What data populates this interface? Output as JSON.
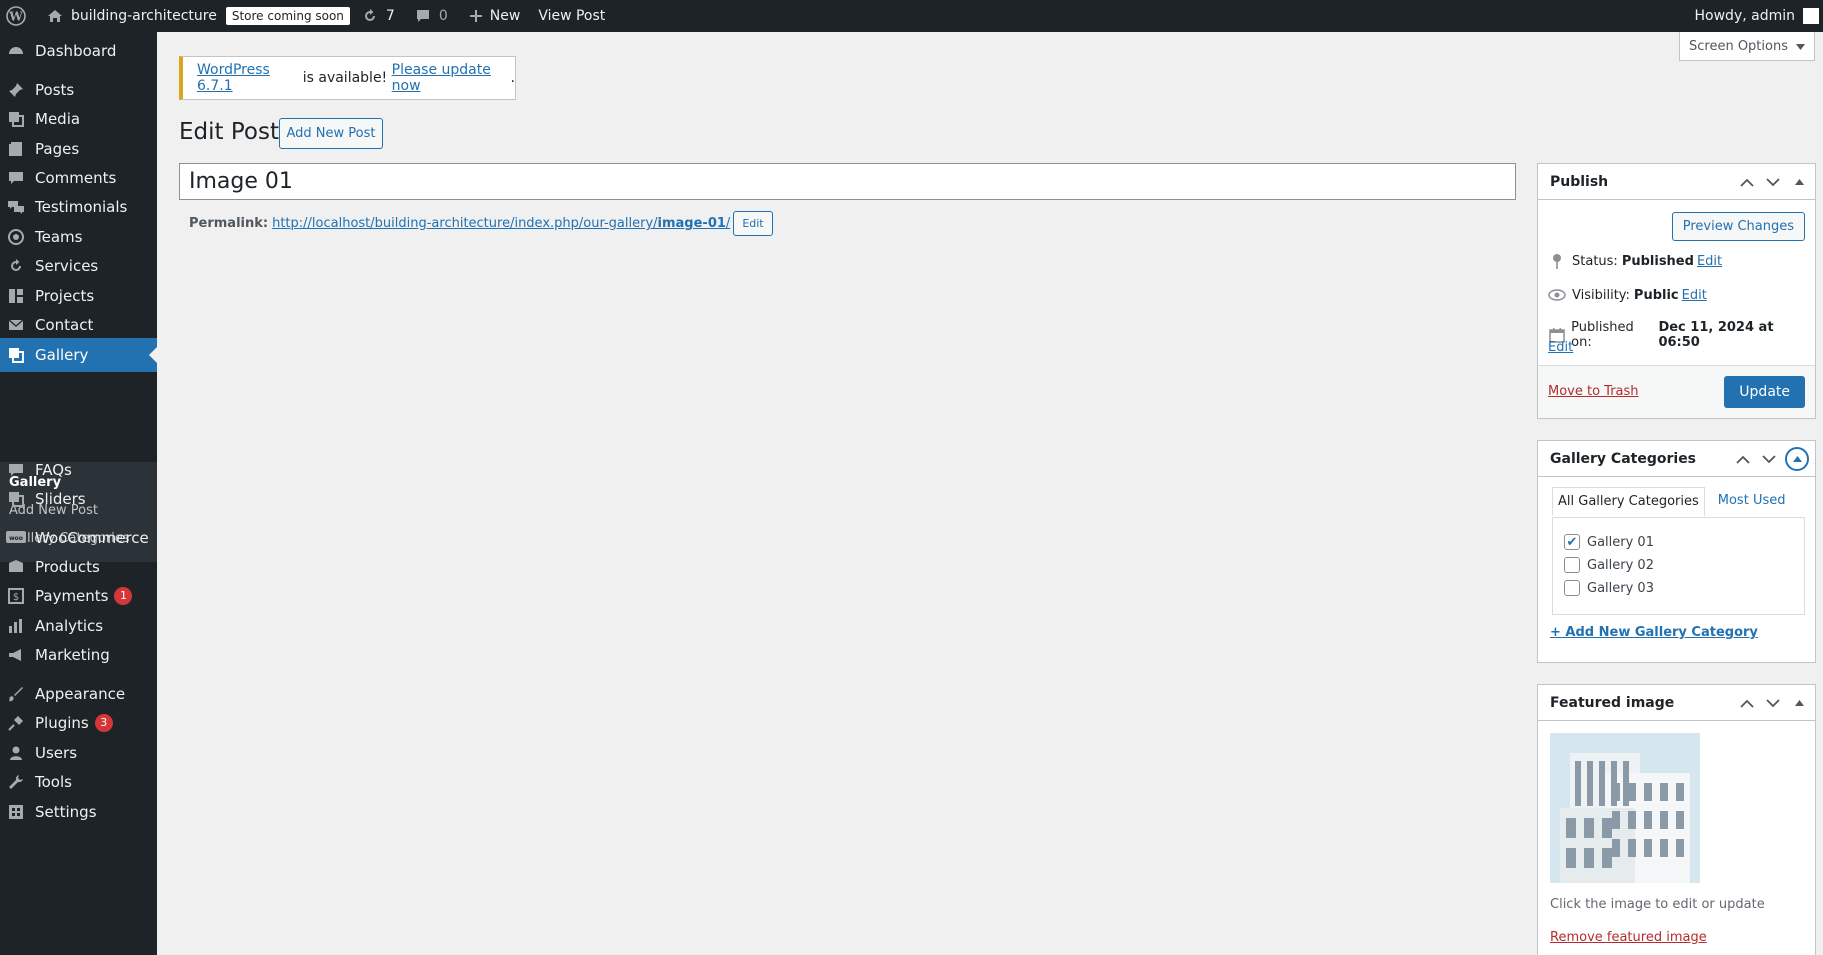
{
  "adminbar": {
    "site_name": "building-architecture",
    "store_badge": "Store coming soon",
    "updates_count": "7",
    "comments_count": "0",
    "new_label": "New",
    "view_post_label": "View Post",
    "howdy": "Howdy, admin"
  },
  "menu": {
    "items": [
      {
        "label": "Dashboard",
        "icon": "dashboard-icon"
      },
      {
        "label": "Posts",
        "icon": "pin-icon"
      },
      {
        "label": "Media",
        "icon": "media-icon"
      },
      {
        "label": "Pages",
        "icon": "pages-icon"
      },
      {
        "label": "Comments",
        "icon": "comments-icon"
      },
      {
        "label": "Testimonials",
        "icon": "testimonials-icon"
      },
      {
        "label": "Teams",
        "icon": "teams-icon"
      },
      {
        "label": "Services",
        "icon": "services-icon"
      },
      {
        "label": "Projects",
        "icon": "projects-icon"
      },
      {
        "label": "Contact",
        "icon": "mail-icon"
      },
      {
        "label": "Gallery",
        "icon": "gallery-icon"
      },
      {
        "label": "FAQs",
        "icon": "faq-icon"
      },
      {
        "label": "Sliders",
        "icon": "sliders-icon"
      },
      {
        "label": "WooCommerce",
        "icon": "woocommerce-icon"
      },
      {
        "label": "Products",
        "icon": "products-icon"
      },
      {
        "label": "Payments",
        "icon": "payments-icon",
        "badge": "1"
      },
      {
        "label": "Analytics",
        "icon": "analytics-icon"
      },
      {
        "label": "Marketing",
        "icon": "marketing-icon"
      },
      {
        "label": "Appearance",
        "icon": "appearance-icon"
      },
      {
        "label": "Plugins",
        "icon": "plugins-icon",
        "badge": "3"
      },
      {
        "label": "Users",
        "icon": "users-icon"
      },
      {
        "label": "Tools",
        "icon": "tools-icon"
      },
      {
        "label": "Settings",
        "icon": "settings-icon"
      }
    ],
    "submenu": [
      "Gallery",
      "Add New Post",
      "Gallery Categories"
    ]
  },
  "screen_options": "Screen Options",
  "notice": {
    "version_link": "WordPress 6.7.1",
    "middle": " is available! ",
    "update_link": "Please update now",
    "end": "."
  },
  "page": {
    "title": "Edit Post",
    "add_new": "Add New Post",
    "post_title": "Image 01",
    "permalink_label": "Permalink:",
    "permalink_base": "http://localhost/building-architecture/index.php/our-gallery/",
    "permalink_slug": "image-01",
    "permalink_trail": "/",
    "permalink_edit": "Edit"
  },
  "publish": {
    "title": "Publish",
    "preview": "Preview Changes",
    "status_label": "Status:",
    "status_value": "Published",
    "visibility_label": "Visibility:",
    "visibility_value": "Public",
    "published_label": "Published on:",
    "published_value": "Dec 11, 2024 at 06:50",
    "edit": "Edit",
    "trash": "Move to Trash",
    "update": "Update"
  },
  "categories": {
    "title": "Gallery Categories",
    "tab_all": "All Gallery Categories",
    "tab_most": "Most Used",
    "items": [
      {
        "label": "Gallery 01",
        "checked": true
      },
      {
        "label": "Gallery 02",
        "checked": false
      },
      {
        "label": "Gallery 03",
        "checked": false
      }
    ],
    "add_new": "+ Add New Gallery Category"
  },
  "featured": {
    "title": "Featured image",
    "hint": "Click the image to edit or update",
    "remove": "Remove featured image"
  },
  "colors": {
    "adminbar_bg": "#1d2327",
    "accent": "#2271b1",
    "danger": "#b32d2e",
    "notice_warning": "#dba617"
  }
}
